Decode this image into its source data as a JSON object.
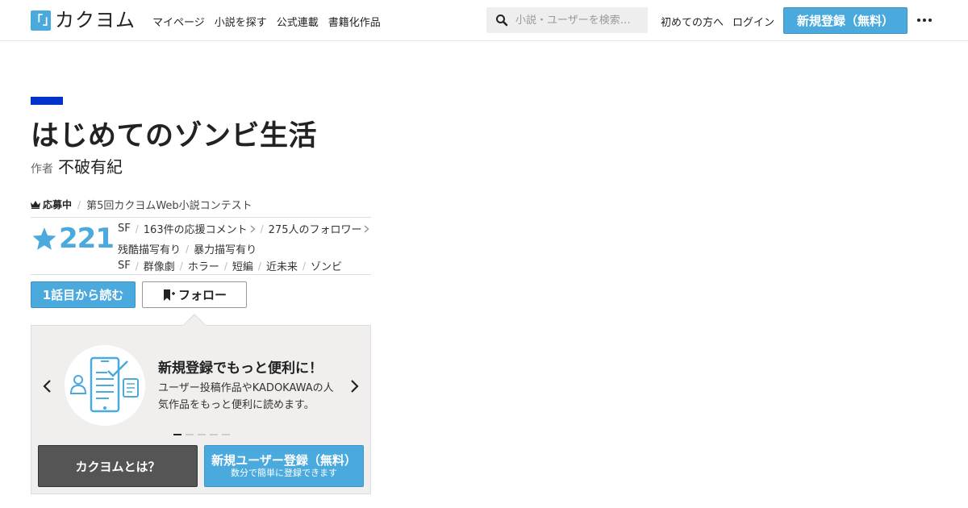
{
  "header": {
    "logo_mark": "「」",
    "logo_text": "カクヨム",
    "nav": [
      "マイページ",
      "小説を探す",
      "公式連載",
      "書籍化作品"
    ],
    "search_placeholder": "小説・ユーザーを検索…",
    "beginners_link": "初めての方へ",
    "login_link": "ログイン",
    "signup_button": "新規登録（無料）"
  },
  "work": {
    "title": "はじめてのゾンビ生活",
    "author_label": "作者",
    "author_name": "不破有紀",
    "contest_status": "応募中",
    "contest_name": "第5回カクヨムWeb小説コンテスト",
    "stars": "221",
    "genre": "SF",
    "comments": "163件の応援コメント",
    "followers": "275人のフォロワー",
    "warnings": [
      "残酷描写有り",
      "暴力描写有り"
    ],
    "tags": [
      "SF",
      "群像劇",
      "ホラー",
      "短編",
      "近未来",
      "ゾンビ"
    ],
    "read_button": "1話目から読む",
    "follow_button": "フォロー"
  },
  "promo": {
    "title": "新規登録でもっと便利に！",
    "body": "ユーザー投稿作品やKADOKAWAの人気作品をもっと便利に読めます。",
    "slide_count": 5,
    "active_slide": 1,
    "about_button": "カクヨムとは？",
    "register_button": "新規ユーザー登録（無料）",
    "register_sub": "数分で簡単に登録できます"
  },
  "colors": {
    "accent_blue": "#4aa9dd",
    "title_bar": "#0033cc",
    "dark_button": "#555555"
  }
}
